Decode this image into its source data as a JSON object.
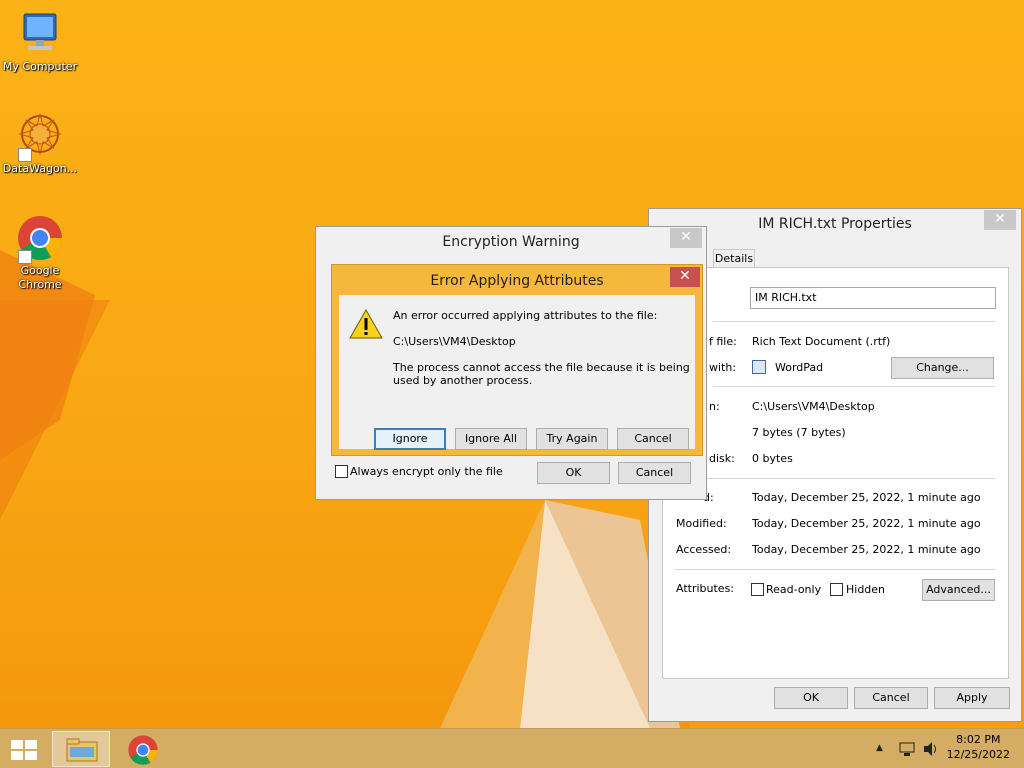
{
  "desktop": {
    "icons": [
      {
        "label": "My Computer",
        "icon": "computer-icon"
      },
      {
        "label": "DataWagon...",
        "icon": "datawagon-icon"
      },
      {
        "label": "Google Chrome",
        "icon": "chrome-icon"
      }
    ]
  },
  "properties": {
    "title": "IM RICH.txt Properties",
    "close": "✕",
    "tab_details": "Details",
    "filename": "IM RICH.txt",
    "type_label": "f file:",
    "type_value": "Rich Text Document (.rtf)",
    "opens_label": "with:",
    "opens_value": "WordPad",
    "change_button": "Change...",
    "location_label": "n:",
    "location_value": "C:\\Users\\VM4\\Desktop",
    "size_value": "7 bytes (7 bytes)",
    "size_disk_label": "disk:",
    "size_disk_value": "0 bytes",
    "created_label": "d:",
    "created_value": "Today, December 25, 2022, 1 minute ago",
    "modified_label": "Modified:",
    "modified_value": "Today, December 25, 2022, 1 minute ago",
    "accessed_label": "Accessed:",
    "accessed_value": "Today, December 25, 2022, 1 minute ago",
    "attributes_label": "Attributes:",
    "readonly_label": "Read-only",
    "hidden_label": "Hidden",
    "advanced_button": "Advanced...",
    "ok_button": "OK",
    "cancel_button": "Cancel",
    "apply_button": "Apply"
  },
  "encryption": {
    "title": "Encryption Warning",
    "close": "✕",
    "always_encrypt_label": "Always encrypt only the file",
    "ok_button": "OK",
    "cancel_button": "Cancel"
  },
  "error": {
    "title": "Error Applying Attributes",
    "close": "✕",
    "message": "An error occurred applying attributes to the file:",
    "path": "C:\\Users\\VM4\\Desktop",
    "detail": "The process cannot access the file because it is being used by another process.",
    "ignore_button": "Ignore",
    "ignore_all_button": "Ignore All",
    "try_again_button": "Try Again",
    "cancel_button": "Cancel"
  },
  "taskbar": {
    "time": "8:02 PM",
    "date": "12/25/2022",
    "tray_arrow": "▲"
  },
  "colors": {
    "error_titlebar": "#f5b83d",
    "close_red": "#c75050",
    "wallpaper": "#fbb216"
  }
}
